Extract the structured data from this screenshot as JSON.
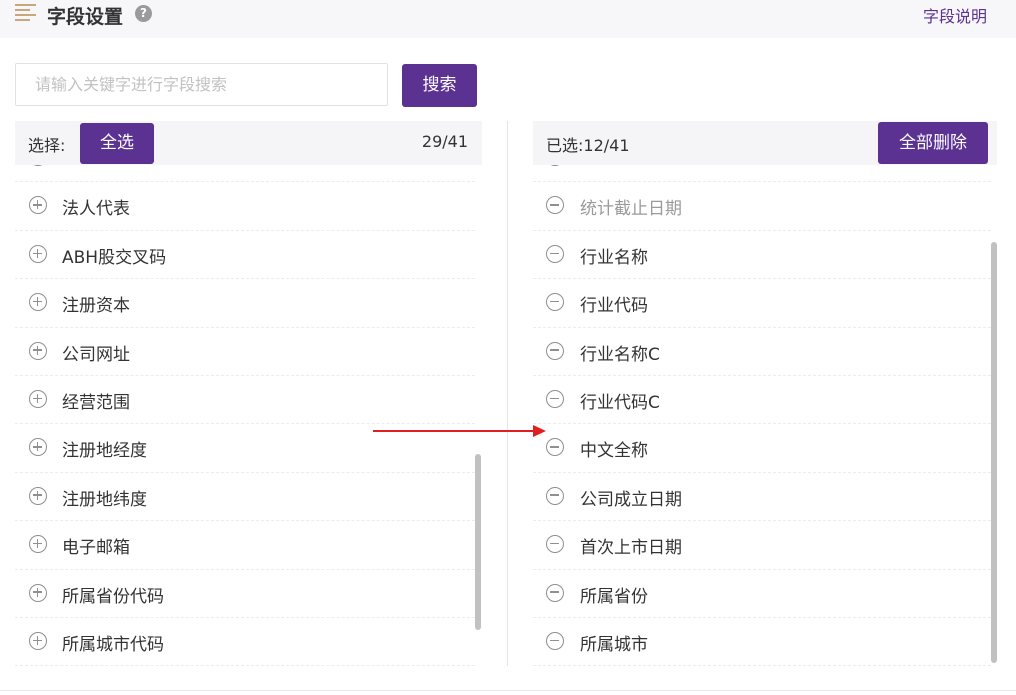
{
  "header": {
    "title": "字段设置",
    "help_icon": "?",
    "explain_link": "字段说明"
  },
  "search": {
    "placeholder": "请输入关键字进行字段搜索",
    "value": "",
    "button_label": "搜索"
  },
  "left_panel": {
    "select_label": "选择:",
    "select_all_label": "全选",
    "count": "29/41",
    "items": [
      "法人代表",
      "ABH股交叉码",
      "注册资本",
      "公司网址",
      "经营范围",
      "注册地经度",
      "注册地纬度",
      "电子邮箱",
      "所属省份代码",
      "所属城市代码"
    ]
  },
  "right_panel": {
    "selected_label": "已选:12/41",
    "delete_all_label": "全部删除",
    "items": [
      {
        "label": "统计截止日期",
        "disabled": true
      },
      {
        "label": "行业名称",
        "disabled": false
      },
      {
        "label": "行业代码",
        "disabled": false
      },
      {
        "label": "行业名称C",
        "disabled": false
      },
      {
        "label": "行业代码C",
        "disabled": false
      },
      {
        "label": "中文全称",
        "disabled": false
      },
      {
        "label": "公司成立日期",
        "disabled": false
      },
      {
        "label": "首次上市日期",
        "disabled": false
      },
      {
        "label": "所属省份",
        "disabled": false
      },
      {
        "label": "所属城市",
        "disabled": false
      }
    ]
  },
  "colors": {
    "accent": "#5b3192",
    "annotation_arrow": "#e02020",
    "icon": "#8f8f8f",
    "menu_icon": "#c9a77a"
  },
  "icons": [
    "menu-icon",
    "help-icon",
    "plus-circle-icon",
    "minus-circle-icon",
    "arrow-annotation"
  ]
}
